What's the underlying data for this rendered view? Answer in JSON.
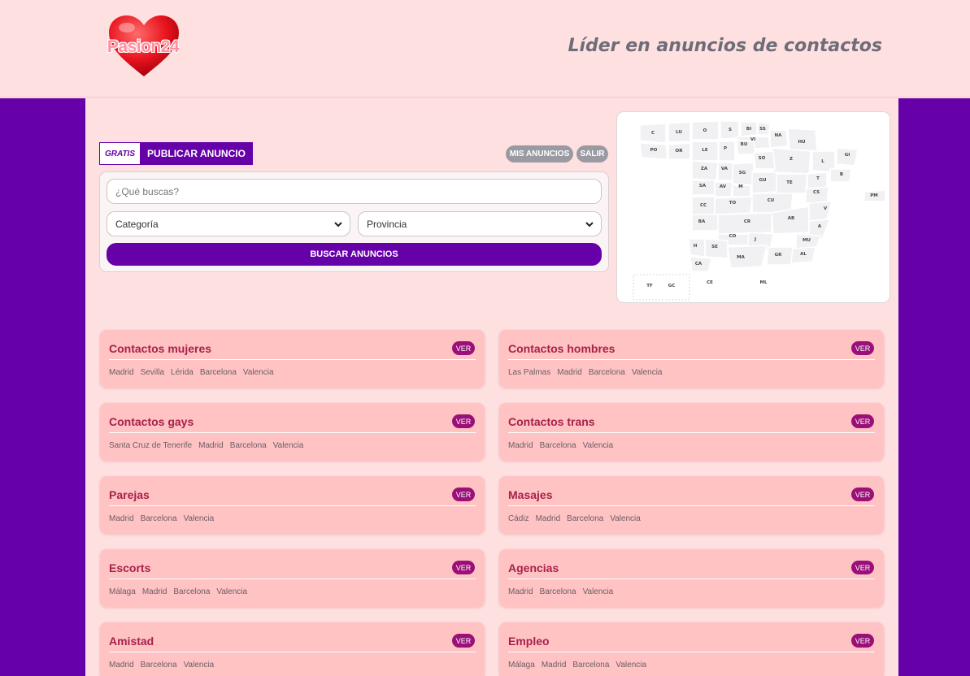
{
  "header": {
    "logo_text": "Pasion24",
    "slogan": "Líder en anuncios de contactos"
  },
  "tabs": {
    "gratis": "GRATIS",
    "publicar": "PUBLICAR ANUNCIO"
  },
  "account": {
    "mis_anuncios": "MIS ANUNCIOS",
    "salir": "SALIR"
  },
  "search": {
    "placeholder": "¿Qué buscas?",
    "category_selected": "Categoría",
    "province_selected": "Provincia",
    "button": "BUSCAR ANUNCIOS"
  },
  "map": {
    "regions": [
      "C",
      "LU",
      "O",
      "S",
      "BI",
      "SS",
      "NA",
      "HU",
      "PO",
      "OR",
      "LE",
      "P",
      "VI",
      "BU",
      "GI",
      "L",
      "B",
      "Z",
      "SO",
      "ZA",
      "VA",
      "SG",
      "SA",
      "AV",
      "M",
      "GU",
      "TE",
      "T",
      "CS",
      "CC",
      "TO",
      "CU",
      "V",
      "PM",
      "BA",
      "CR",
      "AB",
      "A",
      "CO",
      "J",
      "MU",
      "H",
      "SE",
      "MA",
      "GR",
      "AL",
      "CA",
      "TF",
      "GC",
      "CE",
      "ML"
    ]
  },
  "categories": [
    {
      "title": "Contactos mujeres",
      "ver": "VER",
      "cities": [
        "Madrid",
        "Sevilla",
        "Lérida",
        "Barcelona",
        "Valencia"
      ]
    },
    {
      "title": "Contactos hombres",
      "ver": "VER",
      "cities": [
        "Las Palmas",
        "Madrid",
        "Barcelona",
        "Valencia"
      ]
    },
    {
      "title": "Contactos gays",
      "ver": "VER",
      "cities": [
        "Santa Cruz de Tenerife",
        "Madrid",
        "Barcelona",
        "Valencia"
      ]
    },
    {
      "title": "Contactos trans",
      "ver": "VER",
      "cities": [
        "Madrid",
        "Barcelona",
        "Valencia"
      ]
    },
    {
      "title": "Parejas",
      "ver": "VER",
      "cities": [
        "Madrid",
        "Barcelona",
        "Valencia"
      ]
    },
    {
      "title": "Masajes",
      "ver": "VER",
      "cities": [
        "Cádiz",
        "Madrid",
        "Barcelona",
        "Valencia"
      ]
    },
    {
      "title": "Escorts",
      "ver": "VER",
      "cities": [
        "Málaga",
        "Madrid",
        "Barcelona",
        "Valencia"
      ]
    },
    {
      "title": "Agencias",
      "ver": "VER",
      "cities": [
        "Madrid",
        "Barcelona",
        "Valencia"
      ]
    },
    {
      "title": "Amistad",
      "ver": "VER",
      "cities": [
        "Madrid",
        "Barcelona",
        "Valencia"
      ]
    },
    {
      "title": "Empleo",
      "ver": "VER",
      "cities": [
        "Málaga",
        "Madrid",
        "Barcelona",
        "Valencia"
      ]
    }
  ],
  "colors": {
    "background": "#ffe0e0",
    "brand_purple": "#6600a8",
    "card": "#ffc3c4",
    "card_title": "#a8204a",
    "ver_badge": "#9a1078",
    "pill_gray": "#9a9aa3"
  }
}
